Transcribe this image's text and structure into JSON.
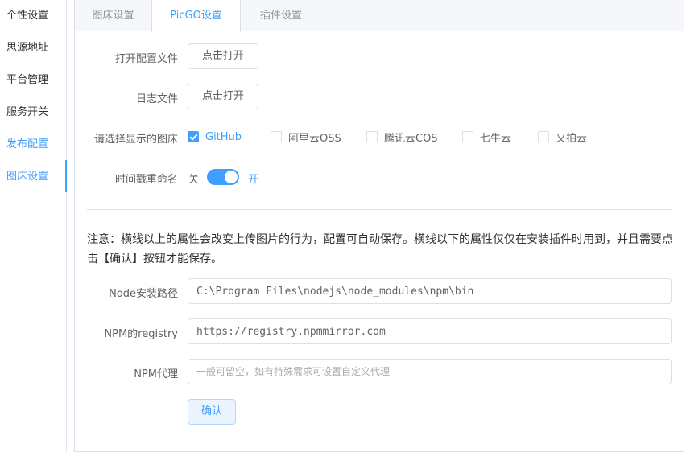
{
  "sidebar": {
    "items": [
      {
        "label": "个性设置"
      },
      {
        "label": "思源地址"
      },
      {
        "label": "平台管理"
      },
      {
        "label": "服务开关"
      },
      {
        "label": "发布配置"
      },
      {
        "label": "图床设置"
      }
    ],
    "active_index": 5
  },
  "tabs": [
    {
      "label": "图床设置"
    },
    {
      "label": "PicGO设置"
    },
    {
      "label": "插件设置"
    }
  ],
  "active_tab": 1,
  "form": {
    "open_config": {
      "label": "打开配置文件",
      "button": "点击打开"
    },
    "log_file": {
      "label": "日志文件",
      "button": "点击打开"
    },
    "image_bed": {
      "label": "请选择显示的图床",
      "options": [
        {
          "label": "GitHub",
          "checked": true
        },
        {
          "label": "阿里云OSS",
          "checked": false
        },
        {
          "label": "腾讯云COS",
          "checked": false
        },
        {
          "label": "七牛云",
          "checked": false
        },
        {
          "label": "又拍云",
          "checked": false
        }
      ]
    },
    "rename": {
      "label": "时间戳重命名",
      "off_text": "关",
      "on_text": "开",
      "enabled": true
    }
  },
  "note": "注意：横线以上的属性会改变上传图片的行为，配置可自动保存。横线以下的属性仅仅在安装插件时用到，并且需要点击【确认】按钮才能保存。",
  "plugin_form": {
    "node_path": {
      "label": "Node安装路径",
      "value": "C:\\Program Files\\nodejs\\node_modules\\npm\\bin"
    },
    "npm_registry": {
      "label": "NPM的registry",
      "value": "https://registry.npmmirror.com"
    },
    "npm_proxy": {
      "label": "NPM代理",
      "value": "",
      "placeholder": "一般可留空，如有特殊需求可设置自定义代理"
    },
    "confirm_button": "确认"
  },
  "colors": {
    "accent": "#409eff",
    "border": "#dcdfe6",
    "text": "#606266"
  }
}
